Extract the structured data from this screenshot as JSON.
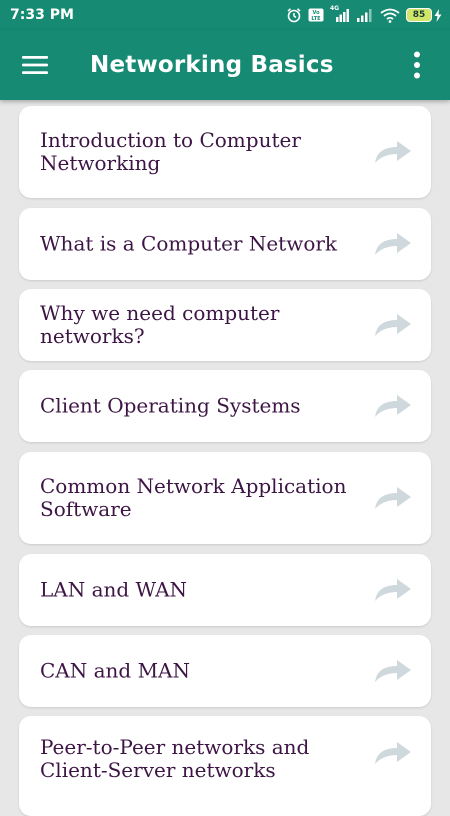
{
  "status_bar": {
    "time": "7:33 PM",
    "network_type": "4G",
    "volte": "VoLTE",
    "battery_level": "85"
  },
  "app_bar": {
    "title": "Networking Basics",
    "menu_icon": "hamburger-menu-icon",
    "overflow_icon": "more-vertical-icon"
  },
  "topics": [
    {
      "label": "Introduction to Computer Networking"
    },
    {
      "label": "What is a Computer Network"
    },
    {
      "label": "Why we need computer networks?"
    },
    {
      "label": "Client Operating Systems"
    },
    {
      "label": "Common Network Application Software"
    },
    {
      "label": "LAN and WAN"
    },
    {
      "label": "CAN and MAN"
    },
    {
      "label": "Peer-to-Peer networks and Client-Server networks"
    }
  ],
  "colors": {
    "primary": "#168a73",
    "background": "#e7e7e7",
    "card": "#ffffff",
    "text": "#3d1544",
    "arrow": "#cfd8dc"
  }
}
